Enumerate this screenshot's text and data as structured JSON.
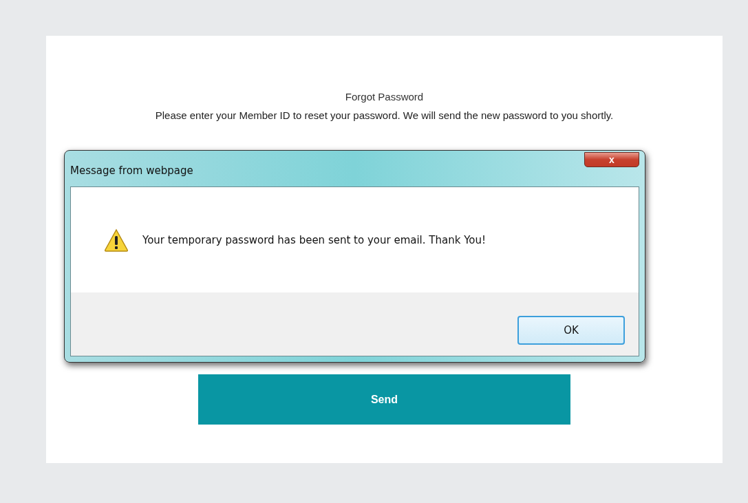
{
  "page": {
    "title": "Forgot Password",
    "description": "Please enter your Member ID to reset your password. We will send the new password to you shortly.",
    "send_button": "Send"
  },
  "dialog": {
    "title": "Message from webpage",
    "close": "x",
    "message": "Your temporary password has been sent to your email. Thank You!",
    "buttons": [
      {
        "label": "OK",
        "selected": true
      }
    ]
  }
}
